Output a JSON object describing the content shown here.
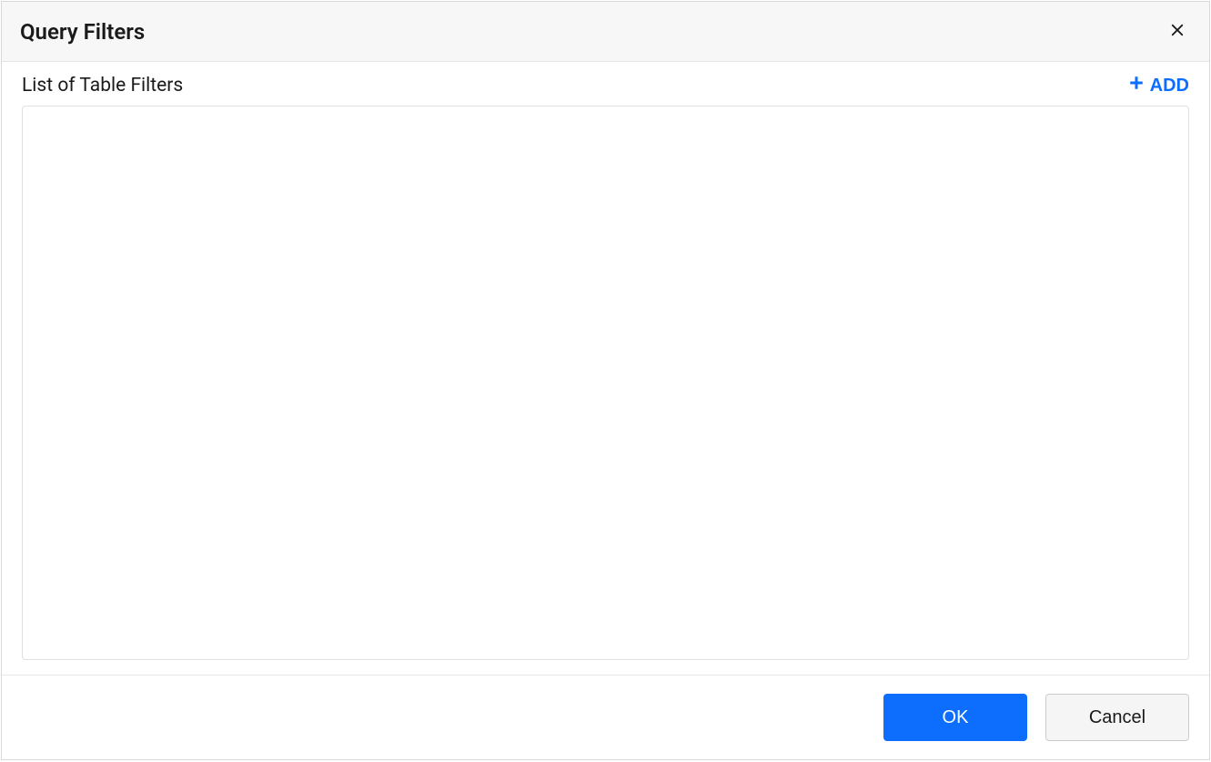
{
  "dialog": {
    "title": "Query Filters"
  },
  "body": {
    "list_label": "List of Table Filters",
    "add_label": "ADD"
  },
  "footer": {
    "ok_label": "OK",
    "cancel_label": "Cancel"
  }
}
